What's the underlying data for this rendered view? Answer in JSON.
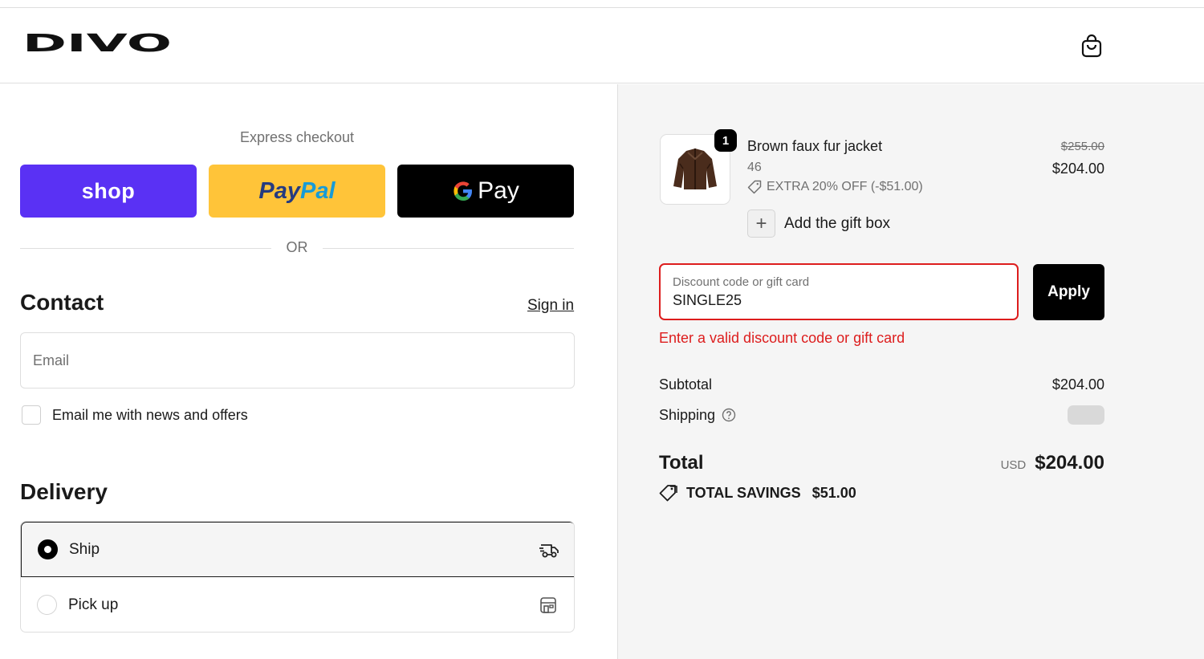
{
  "header": {
    "logo_text": "DIVO",
    "cart_icon": "shopping-bag-icon"
  },
  "express": {
    "title": "Express checkout",
    "shop_label": "shop",
    "paypal_label_1": "Pay",
    "paypal_label_2": "Pal",
    "gpay_label": "Pay",
    "or_label": "OR"
  },
  "contact": {
    "title": "Contact",
    "signin_label": "Sign in",
    "email_placeholder": "Email",
    "email_value": "",
    "newsletter_label": "Email me with news and offers",
    "newsletter_checked": false
  },
  "delivery": {
    "title": "Delivery",
    "options": [
      {
        "label": "Ship",
        "selected": true,
        "icon": "truck-icon"
      },
      {
        "label": "Pick up",
        "selected": false,
        "icon": "store-icon"
      }
    ]
  },
  "order": {
    "item": {
      "name": "Brown faux fur jacket",
      "variant": "46",
      "discount": "EXTRA 20% OFF (-$51.00)",
      "price_original": "$255.00",
      "price": "$204.00",
      "quantity": "1"
    },
    "gift_box_label": "Add the gift box",
    "discount_placeholder": "Discount code or gift card",
    "discount_value": "SINGLE25",
    "apply_label": "Apply",
    "error_text": "Enter a valid discount code or gift card",
    "subtotal_label": "Subtotal",
    "subtotal_value": "$204.00",
    "shipping_label": "Shipping",
    "total_label": "Total",
    "total_currency": "USD",
    "total_value": "$204.00",
    "savings_label": "TOTAL SAVINGS",
    "savings_value": "$51.00"
  },
  "colors": {
    "shop_purple": "#5a31f4",
    "paypal_yellow": "#ffc439",
    "error_red": "#dd1d1d"
  }
}
